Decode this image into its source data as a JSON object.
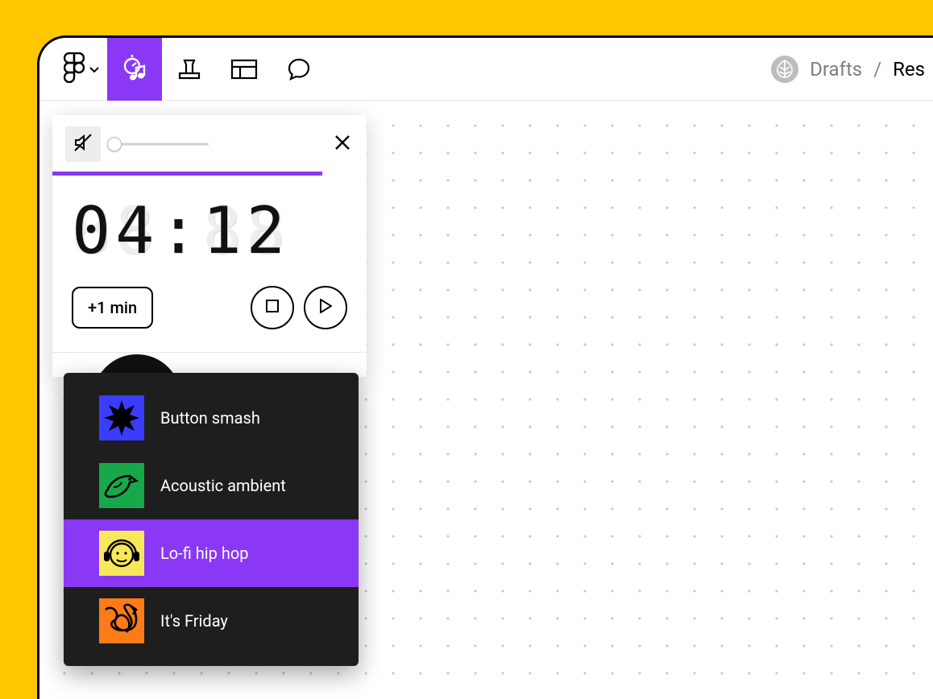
{
  "colors": {
    "accent": "#8a38f5",
    "page_bg": "#ffc700"
  },
  "toolbar": {
    "active_tool": "timer-music"
  },
  "breadcrumb": {
    "loc": "Drafts",
    "sep": "/",
    "cur": "Res"
  },
  "timer": {
    "display": "04:12",
    "progress_pct": 86,
    "add_label": "+1 min",
    "volume_pct": 0,
    "muted": true
  },
  "playlist": {
    "items": [
      {
        "label": "Button smash",
        "thumb_bg": "#3a3cff",
        "selected": false
      },
      {
        "label": "Acoustic ambient",
        "thumb_bg": "#18a84c",
        "selected": false
      },
      {
        "label": "Lo-fi hip hop",
        "thumb_bg": "#f7e85b",
        "selected": true
      },
      {
        "label": "It's Friday",
        "thumb_bg": "#ff7a18",
        "selected": false
      }
    ]
  }
}
